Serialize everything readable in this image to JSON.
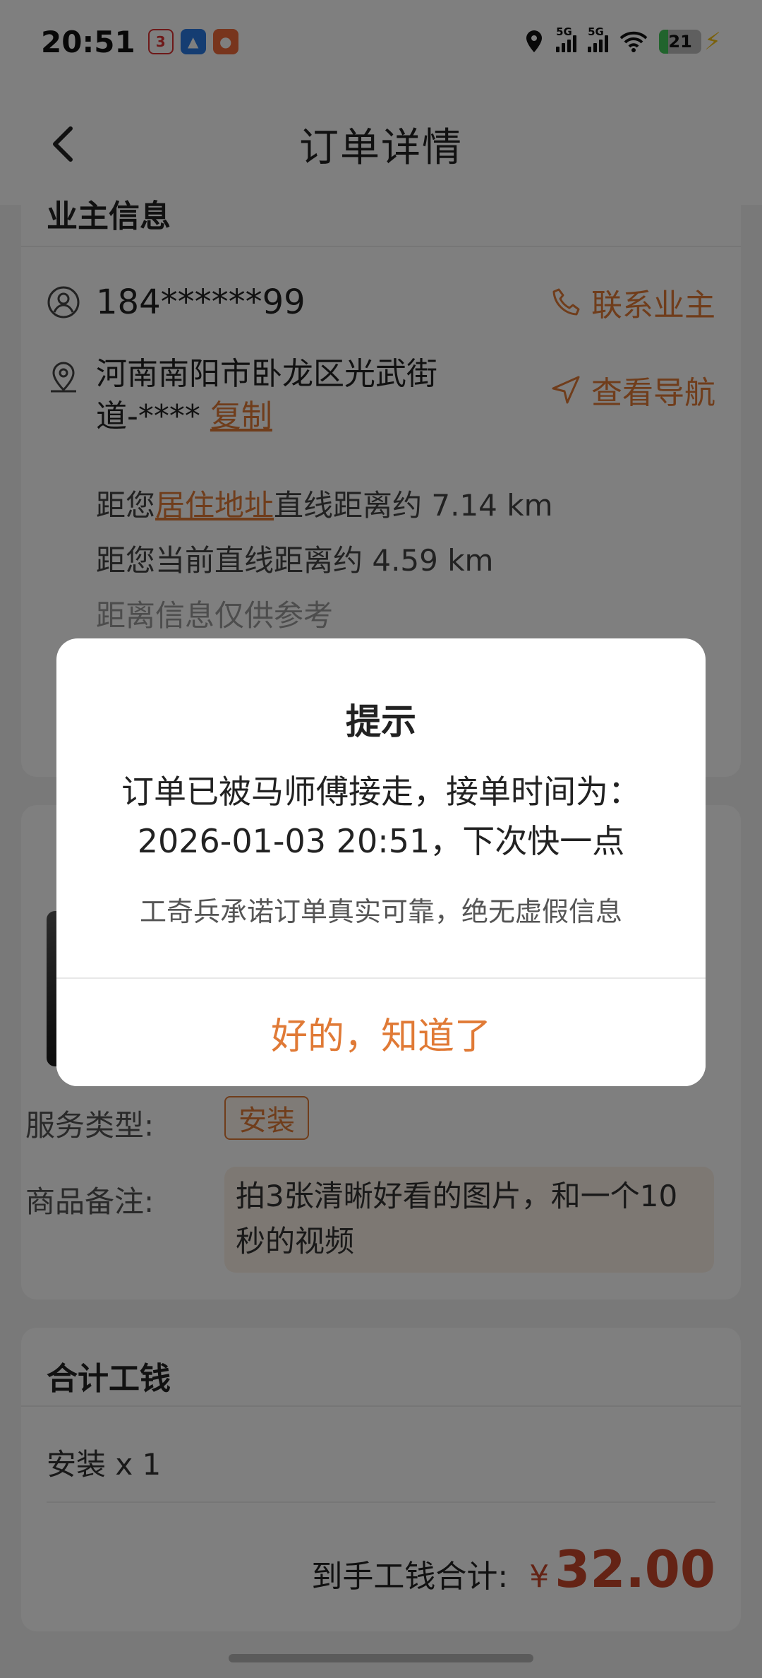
{
  "status_bar": {
    "time": "20:51",
    "app_badge_1": "3",
    "battery": "21",
    "net_1": "5G",
    "net_2": "5G"
  },
  "header": {
    "title": "订单详情"
  },
  "owner_card": {
    "title": "业主信息",
    "phone": "184******99",
    "contact_label": "联系业主",
    "address_line1": "河南南阳市卧龙区光武街",
    "address_line2": "道-****",
    "copy_label": "复制",
    "navigate_label": "查看导航",
    "dist1_prefix": "距您",
    "dist1_link": "居住地址",
    "dist1_suffix": "直线距离约 7.14 km",
    "dist2": "距您当前直线距离约 4.59 km",
    "dist_note": "距离信息仅供参考"
  },
  "product_card": {
    "service_type_label": "服务类型:",
    "service_type_value": "安装",
    "note_label": "商品备注:",
    "note_value": "拍3张清晰好看的图片，和一个10秒的视频"
  },
  "total_card": {
    "title": "合计工钱",
    "item": "安装 x 1",
    "total_label": "到手工钱合计:",
    "currency": "¥",
    "total_value": "32.00"
  },
  "dialog": {
    "title": "提示",
    "message": "订单已被马师傅接走，接单时间为：2026-01-03 20:51，下次快一点",
    "sub": "工奇兵承诺订单真实可靠，绝无虚假信息",
    "button": "好的，知道了"
  },
  "colors": {
    "accent": "#e07a36",
    "price": "#c8462a"
  }
}
